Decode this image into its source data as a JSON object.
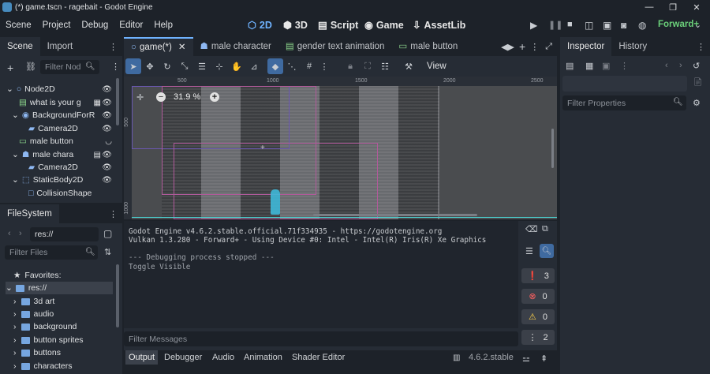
{
  "window": {
    "title": "(*) game.tscn - ragebait - Godot Engine",
    "min": "—",
    "max": "❐",
    "close": "✕"
  },
  "menu": [
    "Scene",
    "Project",
    "Debug",
    "Editor",
    "Help"
  ],
  "modes": [
    {
      "label": "2D",
      "icon": "⬡"
    },
    {
      "label": "3D",
      "icon": "⬢"
    },
    {
      "label": "Script",
      "icon": "▤"
    },
    {
      "label": "Game",
      "icon": "◉"
    },
    {
      "label": "AssetLib",
      "icon": "⇩"
    }
  ],
  "renderer": "Forward+",
  "scene_dock": {
    "tabs": [
      "Scene",
      "Import"
    ],
    "filter_placeholder": "Filter Nod",
    "nodes": [
      {
        "label": "Node2D",
        "color": "#8eb8f2"
      },
      {
        "label": "what is your g",
        "color": "#8eda8e"
      },
      {
        "label": "BackgroundForR",
        "color": "#8eb8f2"
      },
      {
        "label": "Camera2D",
        "color": "#8eb8f2"
      },
      {
        "label": "male button",
        "color": "#8eda8e"
      },
      {
        "label": "male chara",
        "color": "#8eb8f2"
      },
      {
        "label": "Camera2D",
        "color": "#8eb8f2"
      },
      {
        "label": "StaticBody2D",
        "color": "#8eb8f2"
      },
      {
        "label": "CollisionShape",
        "color": "#8eb8f2"
      }
    ]
  },
  "filesystem": {
    "tab": "FileSystem",
    "path": "res://",
    "filter_placeholder": "Filter Files",
    "favorites": "Favorites:",
    "root": "res://",
    "folders": [
      "3d art",
      "audio",
      "background",
      "button sprites",
      "buttons",
      "characters"
    ]
  },
  "editor_tabs": [
    {
      "label": "game(*)",
      "close": "✕"
    },
    {
      "label": "male character"
    },
    {
      "label": "gender text animation"
    },
    {
      "label": "male button"
    }
  ],
  "toolbar": {
    "view": "View"
  },
  "ruler": {
    "marks": [
      "500",
      "1000",
      "1500",
      "2000",
      "2500"
    ],
    "vmarks": [
      "500",
      "1000"
    ]
  },
  "zoom": {
    "minus": "−",
    "value": "31.9 %",
    "plus": "+"
  },
  "output": {
    "lines": [
      "Godot Engine v4.6.2.stable.official.71f334935 - https://godotengine.org",
      "Vulkan 1.3.280 - Forward+ - Using Device #0: Intel - Intel(R) Iris(R) Xe Graphics",
      "",
      "--- Debugging process stopped ---",
      "Toggle Visible"
    ],
    "filter_placeholder": "Filter Messages",
    "counts": {
      "log": "3",
      "errors": "0",
      "warnings": "0",
      "messages": "2"
    }
  },
  "bottom_tabs": [
    "Output",
    "Debugger",
    "Audio",
    "Animation",
    "Shader Editor"
  ],
  "version": "4.6.2.stable",
  "inspector": {
    "tabs": [
      "Inspector",
      "History"
    ],
    "filter_placeholder": "Filter Properties"
  }
}
